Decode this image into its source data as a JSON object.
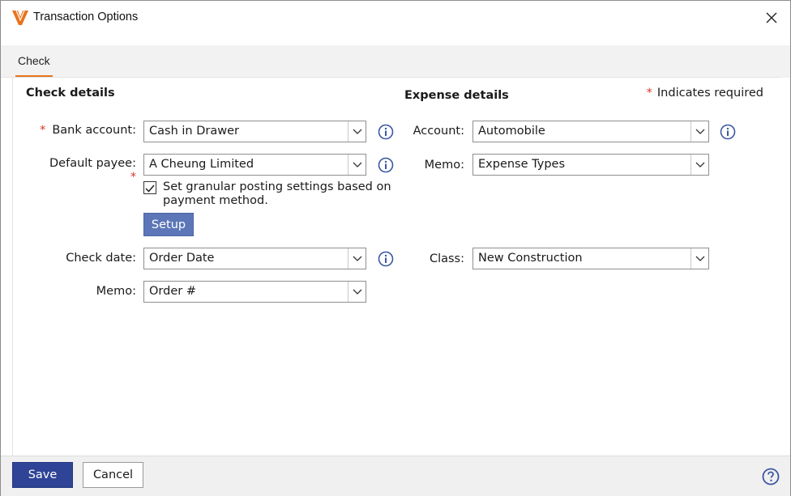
{
  "window": {
    "title": "Transaction Options"
  },
  "tabs": [
    {
      "label": "Check",
      "active": true
    }
  ],
  "check_details": {
    "title": "Check details",
    "bank_account": {
      "label": "Bank account:",
      "value": "Cash in Drawer",
      "required": true
    },
    "default_payee": {
      "label": "Default payee:",
      "value": "A Cheung Limited"
    },
    "granular_posting": {
      "label": "Set granular posting settings based on payment method.",
      "checked": true,
      "required": true
    },
    "setup_button": "Setup",
    "check_date": {
      "label": "Check date:",
      "value": "Order Date"
    },
    "memo": {
      "label": "Memo:",
      "value": "Order #"
    }
  },
  "expense_details": {
    "title": "Expense details",
    "account": {
      "label": "Account:",
      "value": "Automobile"
    },
    "memo": {
      "label": "Memo:",
      "value": "Expense Types"
    },
    "class": {
      "label": "Class:",
      "value": "New Construction"
    }
  },
  "required_note": {
    "star": "*",
    "text": "Indicates required"
  },
  "required_star": "*",
  "footer": {
    "save_label": "Save",
    "cancel_label": "Cancel"
  },
  "colors": {
    "accent": "#e8731a",
    "primary_button": "#2f4496",
    "setup_button": "#5c76b8",
    "info_icon": "#3b57a3",
    "required": "#d9342b"
  },
  "icons": {
    "logo": "app-logo-icon",
    "close": "close-icon",
    "info": "info-icon",
    "help": "help-icon",
    "dropdown": "chevron-down-icon",
    "check": "checkmark-icon"
  }
}
